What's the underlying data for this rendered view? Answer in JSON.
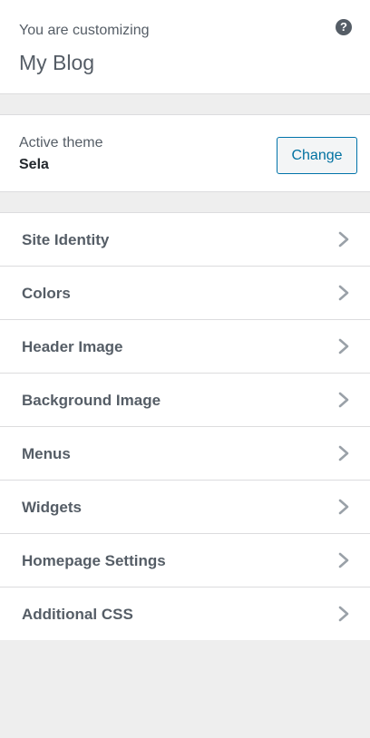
{
  "header": {
    "eyebrow": "You are customizing",
    "site_title": "My Blog",
    "help_icon": "question-circle-icon"
  },
  "theme": {
    "label": "Active theme",
    "name": "Sela",
    "change_label": "Change"
  },
  "menu": {
    "items": [
      {
        "label": "Site Identity",
        "icon": "chevron-right-icon"
      },
      {
        "label": "Colors",
        "icon": "chevron-right-icon"
      },
      {
        "label": "Header Image",
        "icon": "chevron-right-icon"
      },
      {
        "label": "Background Image",
        "icon": "chevron-right-icon"
      },
      {
        "label": "Menus",
        "icon": "chevron-right-icon"
      },
      {
        "label": "Widgets",
        "icon": "chevron-right-icon"
      },
      {
        "label": "Homepage Settings",
        "icon": "chevron-right-icon"
      },
      {
        "label": "Additional CSS",
        "icon": "chevron-right-icon"
      }
    ]
  },
  "colors": {
    "accent": "#0073aa",
    "text": "#555d66",
    "panel_bg": "#eeeeee"
  }
}
